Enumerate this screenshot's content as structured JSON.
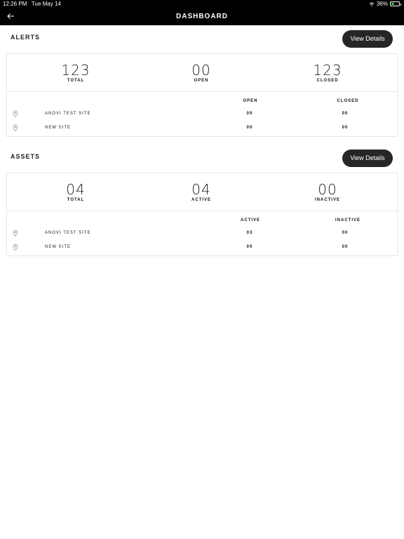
{
  "status_bar": {
    "time": "12:26 PM",
    "date": "Tue May 14",
    "battery": "36%",
    "battery_level": 0.36
  },
  "nav": {
    "title": "DASHBOARD",
    "back_icon": "arrow-left-icon"
  },
  "alerts": {
    "title": "ALERTS",
    "button": "View Details",
    "stats": [
      {
        "value": "123",
        "label": "TOTAL"
      },
      {
        "value": "00",
        "label": "OPEN"
      },
      {
        "value": "123",
        "label": "CLOSED"
      }
    ],
    "columns": [
      "OPEN",
      "CLOSED"
    ],
    "rows": [
      {
        "site": "ANOVI TEST SITE",
        "a": "00",
        "b": "00"
      },
      {
        "site": "NEW SITE",
        "a": "00",
        "b": "00"
      }
    ]
  },
  "assets": {
    "title": "ASSETS",
    "button": "View Details",
    "stats": [
      {
        "value": "04",
        "label": "TOTAL"
      },
      {
        "value": "04",
        "label": "ACTIVE"
      },
      {
        "value": "00",
        "label": "INACTIVE"
      }
    ],
    "columns": [
      "ACTIVE",
      "INACTIVE"
    ],
    "rows": [
      {
        "site": "ANOVI TEST SITE",
        "a": "03",
        "b": "00"
      },
      {
        "site": "NEW SITE",
        "a": "00",
        "b": "00"
      }
    ]
  }
}
